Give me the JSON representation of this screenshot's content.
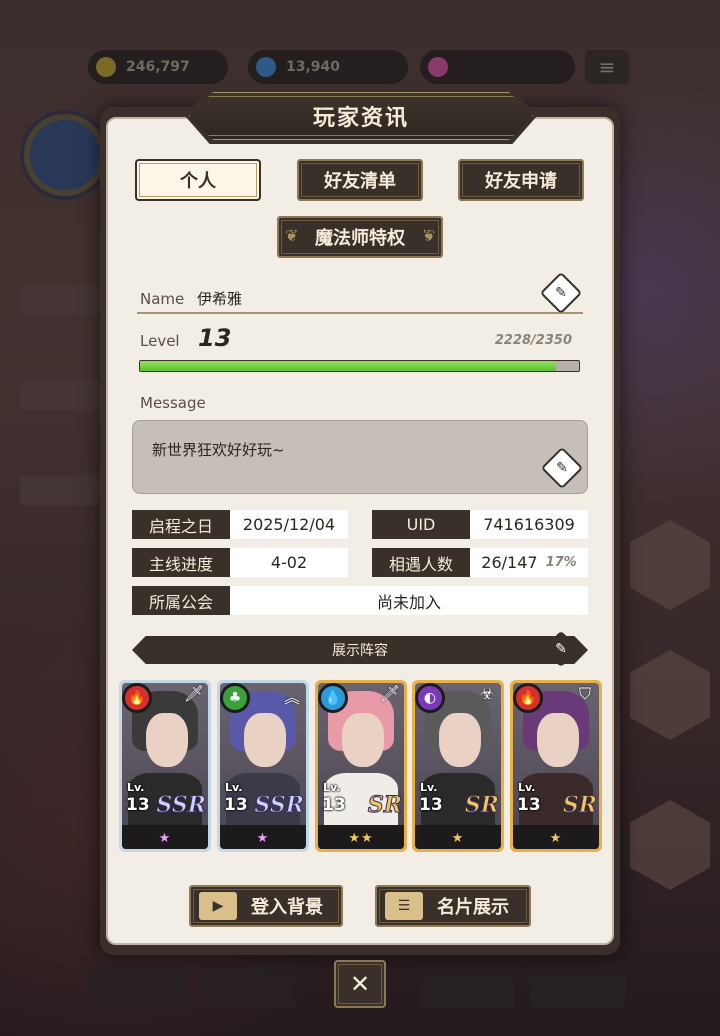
{
  "background": {
    "resources": [
      "246,797",
      "13,940",
      ""
    ]
  },
  "title": "玩家资讯",
  "tabs": {
    "personal": "个人",
    "friend_list": "好友清单",
    "friend_requests": "好友申请",
    "privilege": "魔法师特权"
  },
  "profile": {
    "name_label": "Name",
    "name": "伊希雅",
    "level_label": "Level",
    "level": "13",
    "exp": "2228/2350",
    "exp_fraction": 0.948,
    "message_label": "Message",
    "message": "新世界狂欢好好玩~"
  },
  "info": {
    "start_date_label": "启程之日",
    "start_date": "2025/12/04",
    "uid_label": "UID",
    "uid": "741616309",
    "progress_label": "主线进度",
    "progress": "4-02",
    "encounters_label": "相遇人数",
    "encounters": "26/147",
    "encounters_pct": "17%",
    "guild_label": "所属公会",
    "guild": "尚未加入"
  },
  "lineup": {
    "title": "展示阵容",
    "cards": [
      {
        "lv_label": "Lv.",
        "level": "13",
        "rarity": "SSR",
        "stars": "★",
        "element": "fire-icon",
        "role": "sword-icon",
        "frame": "#c0d8e8",
        "elem_color": "#d3312f",
        "hair": "#3a3a3a",
        "body": "#2a2a2a",
        "rarity_color": "#c8d4ff",
        "star_color": "#e8a0ff"
      },
      {
        "lv_label": "Lv.",
        "level": "13",
        "rarity": "SSR",
        "stars": "★",
        "element": "clover-icon",
        "role": "double-chevron-icon",
        "frame": "#c0d8e8",
        "elem_color": "#3aa03a",
        "hair": "#5a58a8",
        "body": "#3a3a48",
        "rarity_color": "#c8d4ff",
        "star_color": "#e8a0ff"
      },
      {
        "lv_label": "Lv.",
        "level": "13",
        "rarity": "SR",
        "stars": "★★",
        "element": "water-icon",
        "role": "sword-icon",
        "frame": "#e8b048",
        "elem_color": "#2a9ad8",
        "hair": "#e89aa8",
        "body": "#f0ece8",
        "rarity_color": "#f2c85a",
        "star_color": "#f2c85a"
      },
      {
        "lv_label": "Lv.",
        "level": "13",
        "rarity": "SR",
        "stars": "★",
        "element": "dark-icon",
        "role": "biohazard-icon",
        "frame": "#e8b048",
        "elem_color": "#7a3ab8",
        "hair": "#5a5a5a",
        "body": "#2a2a2a",
        "rarity_color": "#f2c85a",
        "star_color": "#f2c85a"
      },
      {
        "lv_label": "Lv.",
        "level": "13",
        "rarity": "SR",
        "stars": "★",
        "element": "fire-icon",
        "role": "shield-icon",
        "frame": "#e8b048",
        "elem_color": "#d3312f",
        "hair": "#6a3a78",
        "body": "#3a2a2a",
        "rarity_color": "#f2c85a",
        "star_color": "#f2c85a"
      }
    ]
  },
  "buttons": {
    "login_background": "登入背景",
    "card_display": "名片展示",
    "close": "✕"
  }
}
